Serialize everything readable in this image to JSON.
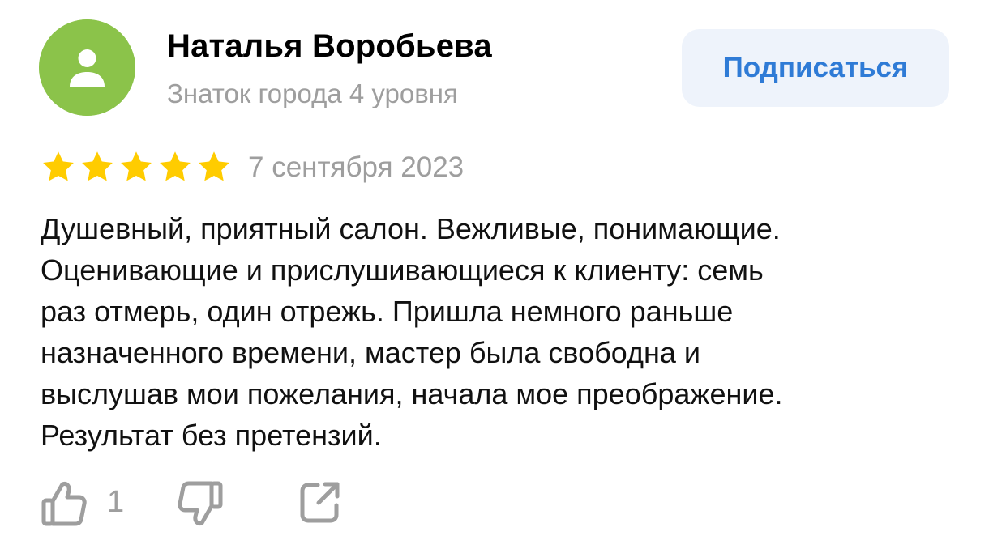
{
  "author": {
    "name": "Наталья Воробьева",
    "level": "Знаток города 4 уровня",
    "avatar_icon": "user-silhouette-icon",
    "avatar_color": "#8bc34a"
  },
  "subscribe": {
    "label": "Подписаться",
    "text_color": "#2f7bd6",
    "background": "#eef3fb"
  },
  "rating": {
    "stars": 5,
    "max": 5,
    "color": "#ffcc00"
  },
  "date": "7 сентября 2023",
  "text_lines": [
    "Душевный, приятный салон. Вежливые, понимающие.",
    "Оценивающие и прислушивающиеся к клиенту: семь",
    "раз отмерь, один отрежь. Пришла немного раньше",
    "назначенного времени, мастер была свободна и",
    "выслушав мои пожелания, начала мое преображение.",
    "Результат без претензий."
  ],
  "actions": {
    "like_icon": "thumbs-up-icon",
    "like_count": "1",
    "dislike_icon": "thumbs-down-icon",
    "share_icon": "share-icon"
  }
}
